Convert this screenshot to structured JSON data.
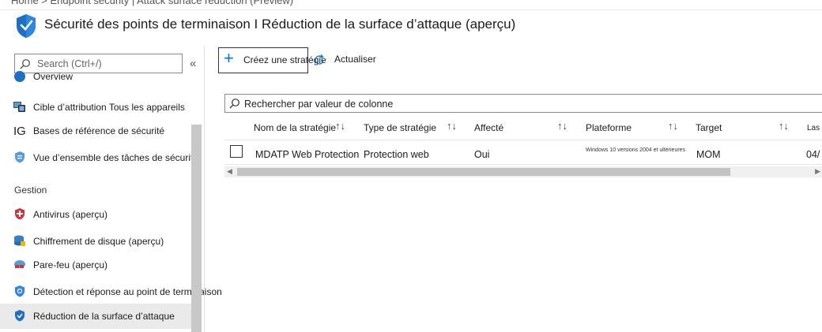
{
  "breadcrumb": "Home > Endpoint security | Attack surface reduction (Preview)",
  "header": {
    "title": "Sécurité des points de terminaison I Réduction de la surface d’attaque (aperçu)",
    "icon": "shield-icon"
  },
  "sidebar": {
    "search_placeholder": "Search (Ctrl+/)",
    "collapse_label": "«",
    "partial_top_item": "Overview",
    "items_top": [
      {
        "label": "Cible d’attribution Tous les appareils",
        "icon": "devices-icon"
      },
      {
        "label": "Bases de référence de sécurité",
        "icon": "baseline-icon",
        "prefix": "IG"
      },
      {
        "label": "Vue d’ensemble des tâches de sécurité",
        "icon": "security-tasks-icon"
      }
    ],
    "section_label": "Gestion",
    "items_manage": [
      {
        "label": "Antivirus (aperçu)",
        "icon": "antivirus-shield-icon"
      },
      {
        "label": "Chiffrement de disque (aperçu)",
        "icon": "disk-encryption-icon"
      },
      {
        "label": "Pare-feu (aperçu)",
        "icon": "firewall-icon"
      },
      {
        "label": "Détection et réponse au point de terminaison",
        "icon": "edr-icon"
      },
      {
        "label": "Réduction de la surface d’attaque",
        "icon": "asr-shield-icon",
        "active": true
      }
    ]
  },
  "toolbar": {
    "create_label": "Créez une stratégie",
    "refresh_label": "Actualiser"
  },
  "filter": {
    "placeholder": "Rechercher par valeur de colonne"
  },
  "table": {
    "columns": [
      "Nom de la stratégie",
      "Type de stratégie",
      "Affecté",
      "Plateforme",
      "Target",
      "Las"
    ],
    "rows": [
      {
        "name": "MDATP Web Protection",
        "type": "Protection web",
        "assigned": "Oui",
        "platform": "Windows 10 versions 2004 et ultérieures",
        "target": "MOM",
        "last": "04/"
      }
    ]
  },
  "colors": {
    "accent": "#0078d4",
    "shield": "#1f6fc5",
    "antivirus": "#d13438"
  }
}
